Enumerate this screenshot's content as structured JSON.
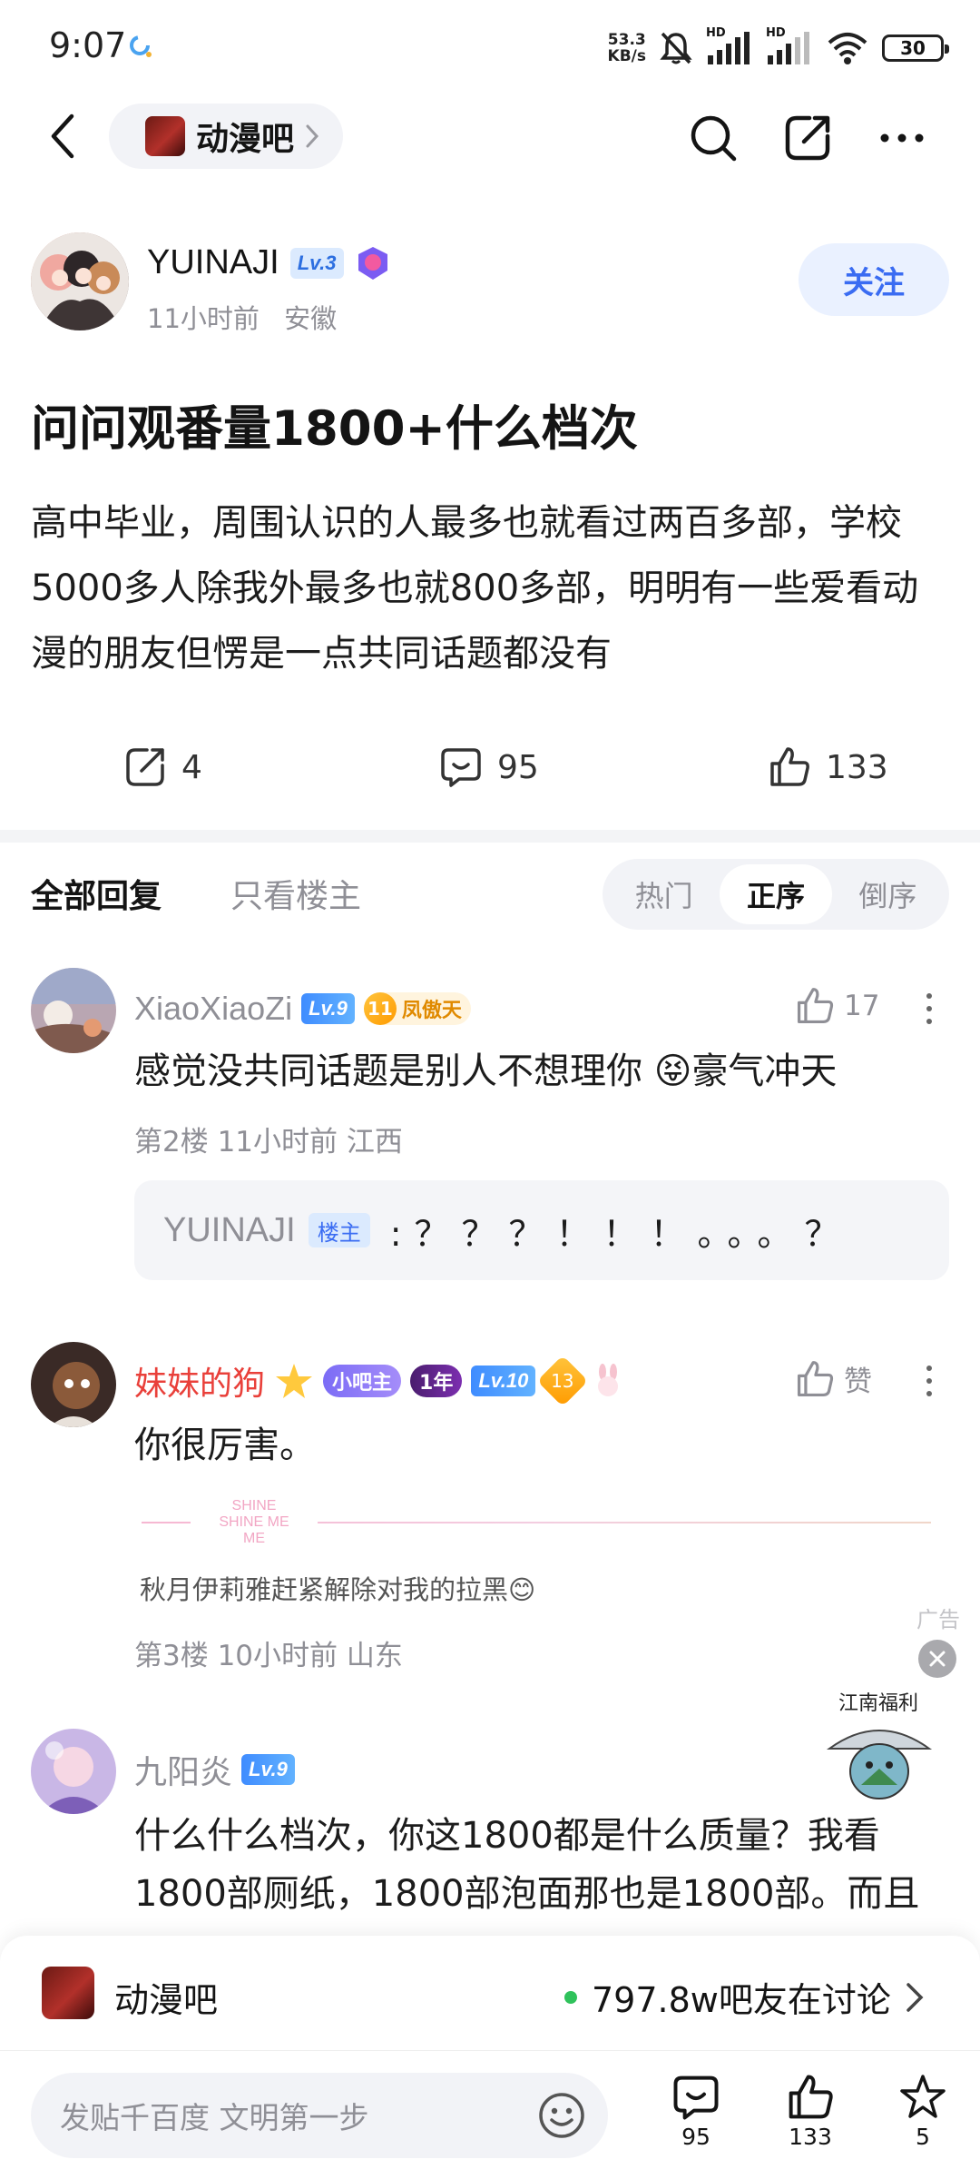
{
  "status_bar": {
    "time": "9:07",
    "net_speed_value": "53.3",
    "net_speed_unit": "KB/s",
    "signal1_label": "HD",
    "signal2_label": "HD",
    "battery": "30"
  },
  "nav": {
    "forum_name": "动漫吧"
  },
  "author": {
    "name": "YUINAJI",
    "level": "Lv.3",
    "time": "11小时前",
    "location": "安徽",
    "follow_label": "关注"
  },
  "post": {
    "title": "问问观番量1800+什么档次",
    "body": "高中毕业，周围认识的人最多也就看过两百多部，学校5000多人除我外最多也就800多部，明明有一些爱看动漫的朋友但愣是一点共同话题都没有",
    "share_count": "4",
    "comment_count": "95",
    "like_count": "133"
  },
  "tabs": {
    "all_replies": "全部回复",
    "op_only": "只看楼主",
    "sort_hot": "热门",
    "sort_asc": "正序",
    "sort_desc": "倒序"
  },
  "comments": [
    {
      "name": "XiaoXiaoZi",
      "level": "Lv.9",
      "fan_level": "11",
      "fan_title": "凤傲天",
      "text": "感觉没共同话题是别人不想理你 😝豪气冲天",
      "meta": "第2楼 11小时前 江西",
      "likes": "17",
      "reply": {
        "name": "YUINAJI",
        "tag": "楼主",
        "text": ":？？？！！！。。。？"
      }
    },
    {
      "name": "妹妹的狗",
      "mod_badge": "小吧主",
      "year_badge": "1年",
      "level": "Lv.10",
      "fan_level": "13",
      "text": "你很厉害。",
      "signature": "秋月伊莉雅赶紧解除对我的拉黑😊",
      "sig_art_text": "SHINE SHINE ME ME",
      "meta": "第3楼 10小时前 山东",
      "likes": "赞"
    },
    {
      "name": "九阳炎",
      "level": "Lv.9",
      "text_line1": "什么什么档次，你这1800都是什么质量？我看",
      "text_line2": "1800部厕纸，1800部泡面那也是1800部。而且"
    }
  ],
  "ad": {
    "label": "广告",
    "caption": "江南福利"
  },
  "forum_bar": {
    "name": "动漫吧",
    "online": "797.8w吧友在讨论"
  },
  "input_bar": {
    "placeholder": "发贴千百度 文明第一步",
    "comments": "95",
    "likes": "133",
    "favorites": "5"
  },
  "colors": {
    "accent": "#3a6cf2",
    "red_name": "#e9403a",
    "muted": "#8f8f96"
  }
}
